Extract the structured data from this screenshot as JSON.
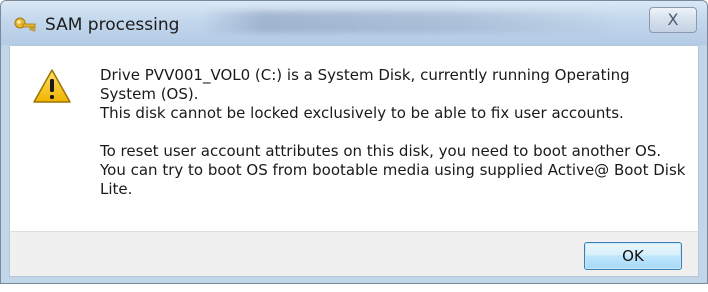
{
  "dialog": {
    "title": "SAM processing",
    "close_label": "X",
    "message_lines": [
      "Drive PVV001_VOL0 (C:) is a System Disk, currently running Operating System (OS).",
      "This disk cannot be locked exclusively to be able to fix user accounts."
    ],
    "message_lines_2": [
      "To reset user account attributes on this disk, you need to boot another OS.",
      "You can try to boot OS from bootable media using supplied Active@ Boot Disk Lite."
    ],
    "ok_label": "OK",
    "icons": {
      "app": "key-icon",
      "warning": "warning-icon"
    }
  }
}
